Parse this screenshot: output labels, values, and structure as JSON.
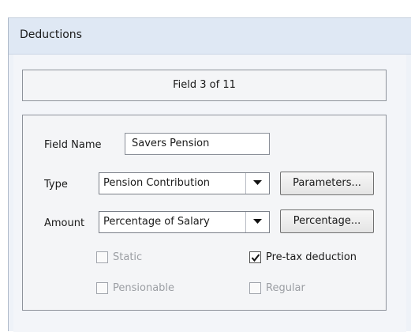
{
  "window": {
    "title": "Deductions"
  },
  "navigator": {
    "field_counter": "Field 3 of 11"
  },
  "form": {
    "field_name": {
      "label": "Field Name",
      "value": "Savers Pension"
    },
    "type": {
      "label": "Type",
      "selected": "Pension Contribution",
      "button": "Parameters..."
    },
    "amount": {
      "label": "Amount",
      "selected": "Percentage of Salary",
      "button": "Percentage..."
    },
    "checkboxes": {
      "static": {
        "label": "Static",
        "checked": false,
        "enabled": false
      },
      "pre_tax": {
        "label": "Pre-tax deduction",
        "checked": true,
        "enabled": true
      },
      "pensionable": {
        "label": "Pensionable",
        "checked": false,
        "enabled": false
      },
      "regular": {
        "label": "Regular",
        "checked": false,
        "enabled": false
      }
    }
  },
  "icons": {
    "dropdown": "chevron-down-icon",
    "check": "checkmark-icon"
  }
}
